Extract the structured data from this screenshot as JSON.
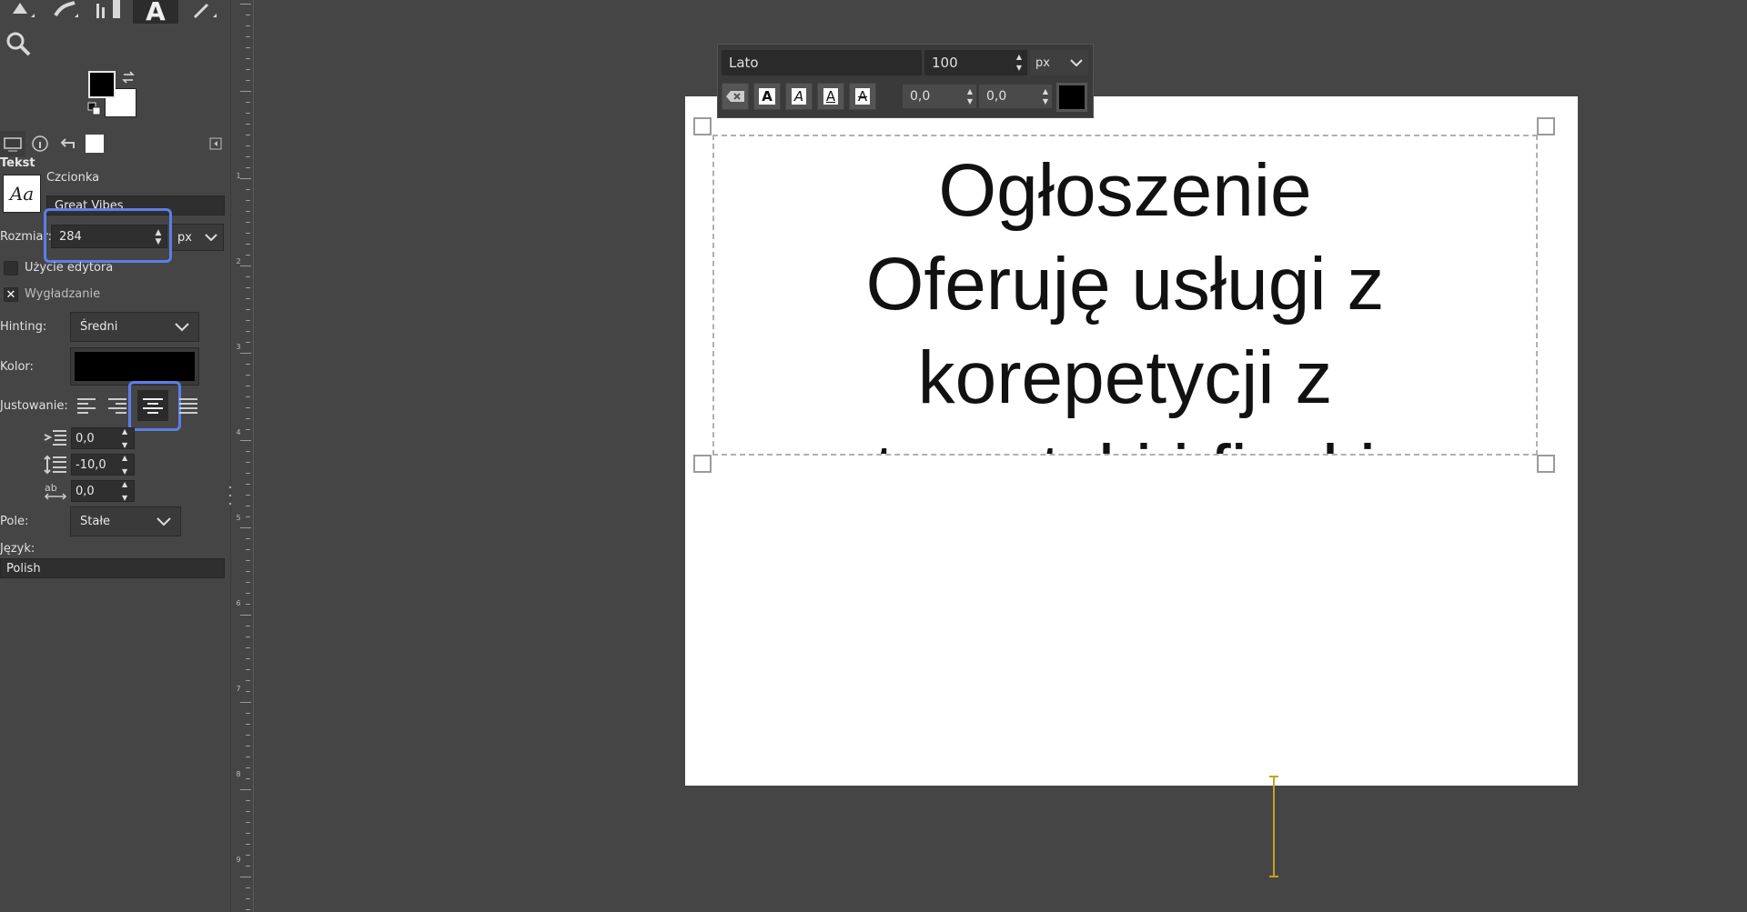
{
  "tool_options": {
    "section_title": "Tekst",
    "font_label": "Czcionka",
    "font_value": "Great Vibes",
    "font_preview": "Aa",
    "size_label": "Rozmiar:",
    "size_value": "284",
    "size_unit": "px",
    "use_editor_label": "Użycie edytora",
    "use_editor_checked": false,
    "antialias_label": "Wygładzanie",
    "antialias_checked": true,
    "hinting_label": "Hinting:",
    "hinting_value": "Średni",
    "color_label": "Kolor:",
    "color_value": "#000000",
    "justify_label": "Justowanie:",
    "indent_value": "0,0",
    "line_spacing_value": "-10,0",
    "letter_spacing_value": "0,0",
    "box_label": "Pole:",
    "box_value": "Stałe",
    "language_label": "Język:",
    "language_value": "Polish"
  },
  "floating_toolbar": {
    "font": "Lato",
    "size": "100",
    "unit": "px",
    "baseline": "0,0",
    "kerning": "0,0",
    "color": "#000000",
    "format_buttons": [
      "A",
      "A",
      "A",
      "A"
    ]
  },
  "canvas_text": {
    "lines": [
      "Ogłoszenie",
      "Oferuję usługi z",
      "korepetycji z",
      "matematyki i fizyki na"
    ]
  },
  "vruler_labels": [
    "1",
    "2",
    "3",
    "4",
    "5",
    "6",
    "7",
    "8",
    "9"
  ],
  "colors": {
    "background": "#454545",
    "highlight": "#5b7fe8",
    "canvas": "#ffffff"
  }
}
